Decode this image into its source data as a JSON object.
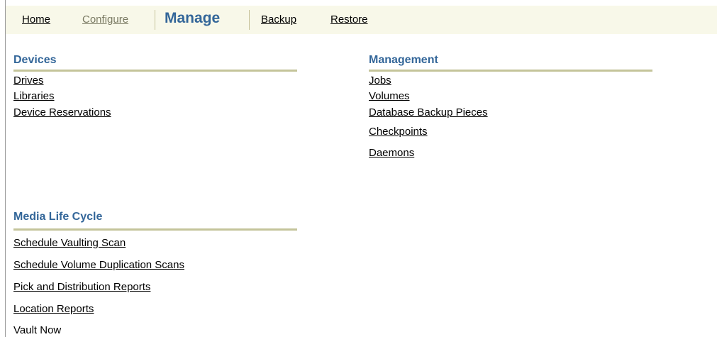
{
  "nav": {
    "home": "Home",
    "configure": "Configure",
    "manage": "Manage",
    "backup": "Backup",
    "restore": "Restore"
  },
  "sections": {
    "devices": {
      "title": "Devices",
      "links": [
        "Drives",
        "Libraries",
        "Device Reservations"
      ]
    },
    "management": {
      "title": "Management",
      "links": [
        "Jobs",
        "Volumes",
        "Database Backup Pieces",
        "Checkpoints",
        "Daemons"
      ]
    },
    "media_life_cycle": {
      "title": "Media Life Cycle",
      "links": [
        "Schedule Vaulting Scan",
        "Schedule Volume Duplication Scans",
        "Pick and Distribution Reports",
        "Location Reports"
      ],
      "static_item": "Vault Now"
    }
  },
  "colors": {
    "accent": "#336699",
    "navbar_bg": "#f8f8e9",
    "rule": "#c4c49a",
    "inactive_tab": "#7a7a63"
  }
}
